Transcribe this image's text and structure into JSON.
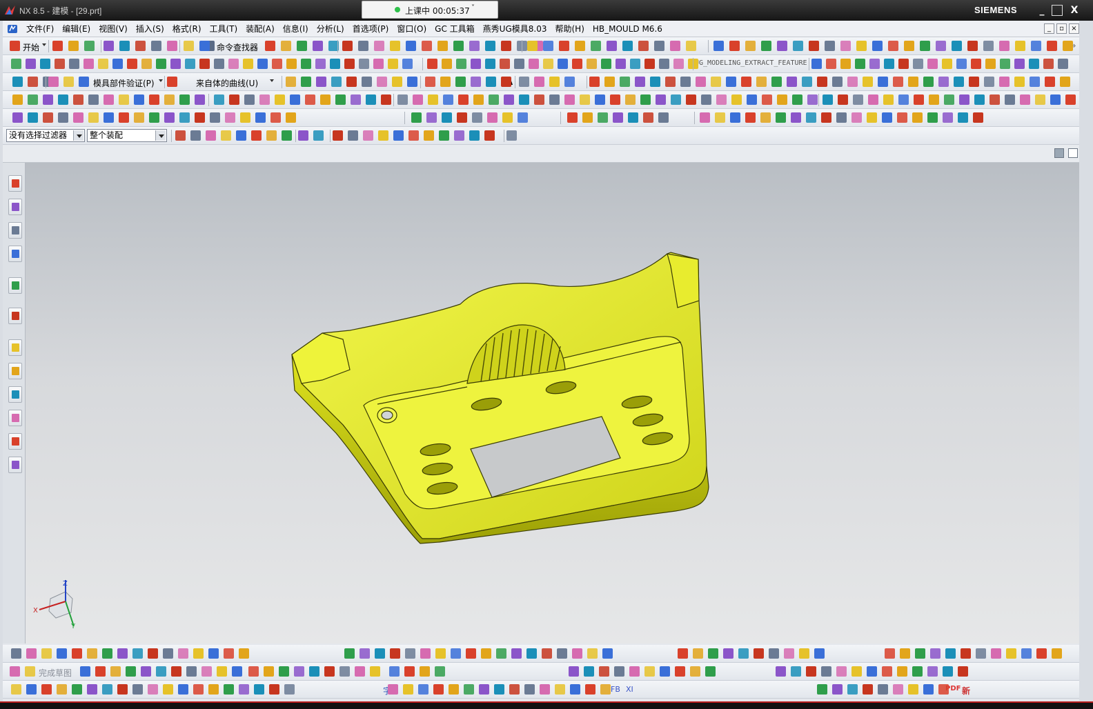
{
  "window": {
    "title": "NX 8.5 - 建模 - [29.prt]",
    "brand": "SIEMENS",
    "buttons": {
      "minimize": "_",
      "maximize": "□",
      "close": "X"
    }
  },
  "recording": {
    "status": "上课中 00:05:37",
    "chevron": "˅"
  },
  "menu": {
    "items": [
      "文件(F)",
      "编辑(E)",
      "视图(V)",
      "插入(S)",
      "格式(R)",
      "工具(T)",
      "装配(A)",
      "信息(I)",
      "分析(L)",
      "首选项(P)",
      "窗口(O)",
      "GC 工具箱",
      "燕秀UG模具8.03",
      "帮助(H)",
      "HB_MOULD M6.6"
    ],
    "mdi": {
      "minimize": "_",
      "restore": "▫",
      "close": "×"
    }
  },
  "toolbar": {
    "start_label": "开始",
    "command_finder_label": "命令查找器",
    "mold_verify_label": "模具部件验证(P)",
    "curve_from_body_label": "来自体的曲线(U)",
    "extract_feature_label": "UG_MODELING_EXTRACT_FEATURE",
    "text_tool_label": "A",
    "overflow": "»"
  },
  "selection": {
    "filter_value": "没有选择过滤器",
    "scope_value": "整个装配"
  },
  "bottom_toolbar": {
    "finish_sketch_label": "完成草图",
    "text_label": "字",
    "fb_label": "FB",
    "xi_label": "XI",
    "pdf_label": "PDF",
    "new_label": "新"
  },
  "triad": {
    "x": "X",
    "y": "Y",
    "z": "Z"
  },
  "colors": {
    "part_fill": "#e8ee2a",
    "part_shade": "#a9ad10",
    "part_edge": "#3a3c05",
    "titlebar": "#1e1e1e",
    "status_dot": "#2ec04a"
  }
}
